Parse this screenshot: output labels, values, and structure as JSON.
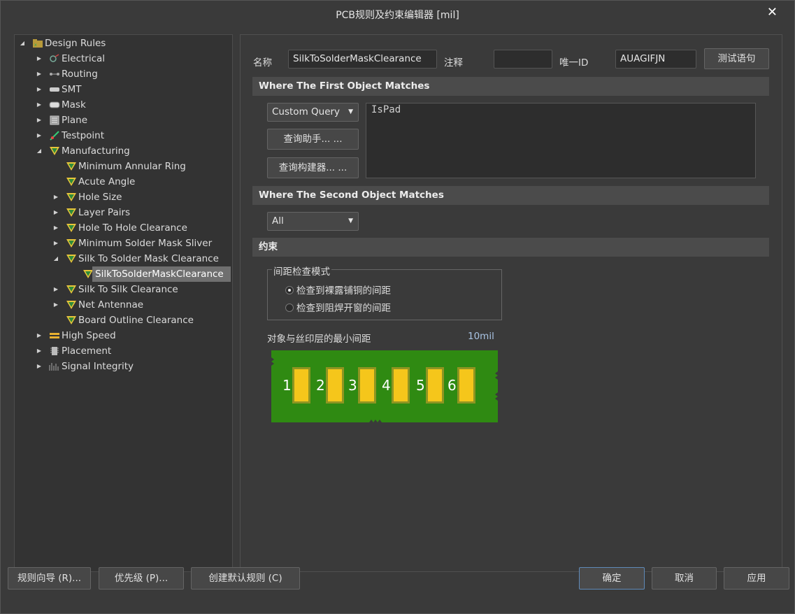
{
  "window": {
    "title": "PCB规则及约束编辑器 [mil]",
    "close_glyph": "✕"
  },
  "tree": {
    "root": "Design Rules",
    "items": [
      {
        "label": "Electrical"
      },
      {
        "label": "Routing"
      },
      {
        "label": "SMT"
      },
      {
        "label": "Mask"
      },
      {
        "label": "Plane"
      },
      {
        "label": "Testpoint"
      },
      {
        "label": "Manufacturing"
      },
      {
        "label": "Minimum Annular Ring"
      },
      {
        "label": "Acute Angle"
      },
      {
        "label": "Hole Size"
      },
      {
        "label": "Layer Pairs"
      },
      {
        "label": "Hole To Hole Clearance"
      },
      {
        "label": "Minimum Solder Mask Sliver"
      },
      {
        "label": "Silk To Solder Mask Clearance"
      },
      {
        "label": "SilkToSolderMaskClearance"
      },
      {
        "label": "Silk To Silk Clearance"
      },
      {
        "label": "Net Antennae"
      },
      {
        "label": "Board Outline Clearance"
      },
      {
        "label": "High Speed"
      },
      {
        "label": "Placement"
      },
      {
        "label": "Signal Integrity"
      }
    ]
  },
  "rule": {
    "name_label": "名称",
    "name_value": "SilkToSolderMaskClearance",
    "comment_label": "注释",
    "comment_value": "",
    "uid_label": "唯一ID",
    "uid_value": "AUAGIFJN",
    "test_button": "测试语句"
  },
  "first": {
    "header": "Where The First Object Matches",
    "query_type": "Custom Query",
    "helper_button": "查询助手... ...",
    "builder_button": "查询构建器... ...",
    "query_text": "IsPad"
  },
  "second": {
    "header": "Where The Second Object Matches",
    "scope": "All"
  },
  "constraints": {
    "header": "约束",
    "group_title": "间距检查模式",
    "option_1": "检查到裸露铺铜的间距",
    "option_2": "检查到阻焊开窗的间距",
    "selected_option": 1,
    "min_label": "对象与丝印层的最小间距",
    "min_value": "10mil",
    "pad_numbers": [
      "1",
      "2",
      "3",
      "4",
      "5",
      "6"
    ],
    "board_color": "#2f8a12",
    "pad_color": "#f5c61b"
  },
  "footer": {
    "wizard_button": "规则向导 (R)...",
    "priority_button": "优先级 (P)...",
    "default_button": "创建默认规则 (C)",
    "ok_button": "确定",
    "cancel_button": "取消",
    "apply_button": "应用"
  }
}
